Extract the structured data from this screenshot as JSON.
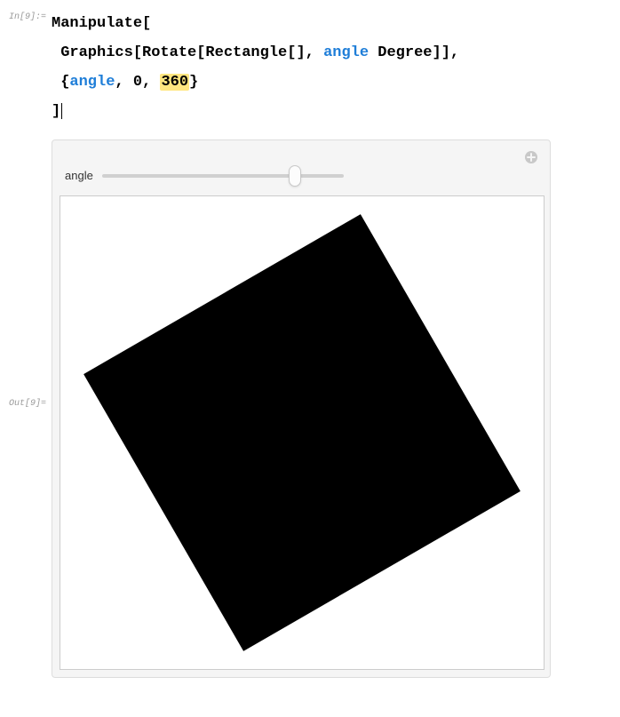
{
  "input": {
    "label": "In[9]:=",
    "code": {
      "line1_a": "Manipulate[",
      "line2_a": " Graphics[Rotate[Rectangle[], ",
      "line2_var": "angle",
      "line2_b": " Degree]],",
      "line3_a": " {",
      "line3_var": "angle",
      "line3_b": ", 0, ",
      "line3_hl": "360",
      "line3_c": "}",
      "line4_a": "]"
    }
  },
  "output": {
    "label": "Out[9]=",
    "slider_label": "angle",
    "slider_value_percent": "80"
  }
}
